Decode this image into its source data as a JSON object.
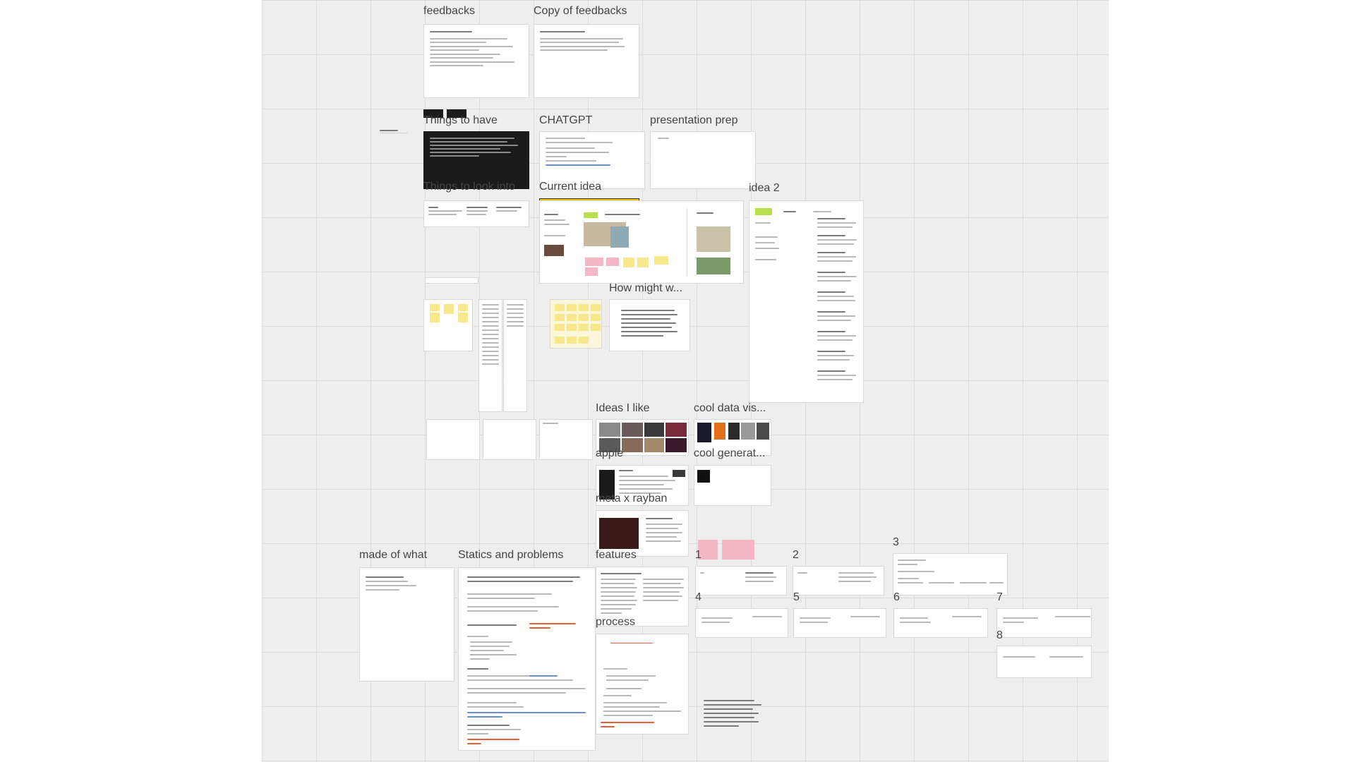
{
  "board": {
    "frames": [
      {
        "id": "feedbacks",
        "label": "feedbacks"
      },
      {
        "id": "copy-of-feedbacks",
        "label": "Copy of feedbacks"
      },
      {
        "id": "things-to-have",
        "label": "Things to have"
      },
      {
        "id": "chatgpt",
        "label": "CHATGPT"
      },
      {
        "id": "presentation-prep",
        "label": "presentation prep"
      },
      {
        "id": "things-to-look-into",
        "label": "Things to look into"
      },
      {
        "id": "current-idea",
        "label": "Current idea"
      },
      {
        "id": "idea-2",
        "label": "idea 2"
      },
      {
        "id": "how-might-we",
        "label": "How might w..."
      },
      {
        "id": "ideas-i-like",
        "label": "Ideas I like"
      },
      {
        "id": "cool-data-vis",
        "label": "cool data vis..."
      },
      {
        "id": "apple",
        "label": "apple"
      },
      {
        "id": "cool-generat",
        "label": "cool generat..."
      },
      {
        "id": "meta-x-rayban",
        "label": "meta x rayban"
      },
      {
        "id": "made-of-what",
        "label": "made of what"
      },
      {
        "id": "statics-and-problems",
        "label": "Statics and problems"
      },
      {
        "id": "features",
        "label": "features"
      },
      {
        "id": "process",
        "label": "process"
      }
    ],
    "numbered_frames": [
      "1",
      "2",
      "3",
      "4",
      "5",
      "6",
      "7",
      "8"
    ]
  },
  "colors": {
    "board_bg": "#eeeeee",
    "grid": "#dcdcdc",
    "sticky_yellow": "#f7e98b",
    "sticky_pink": "#f5b6c6",
    "highlight_bar": "#f2c200",
    "accent_red": "#e0603a",
    "accent_green": "#b8e04a"
  }
}
